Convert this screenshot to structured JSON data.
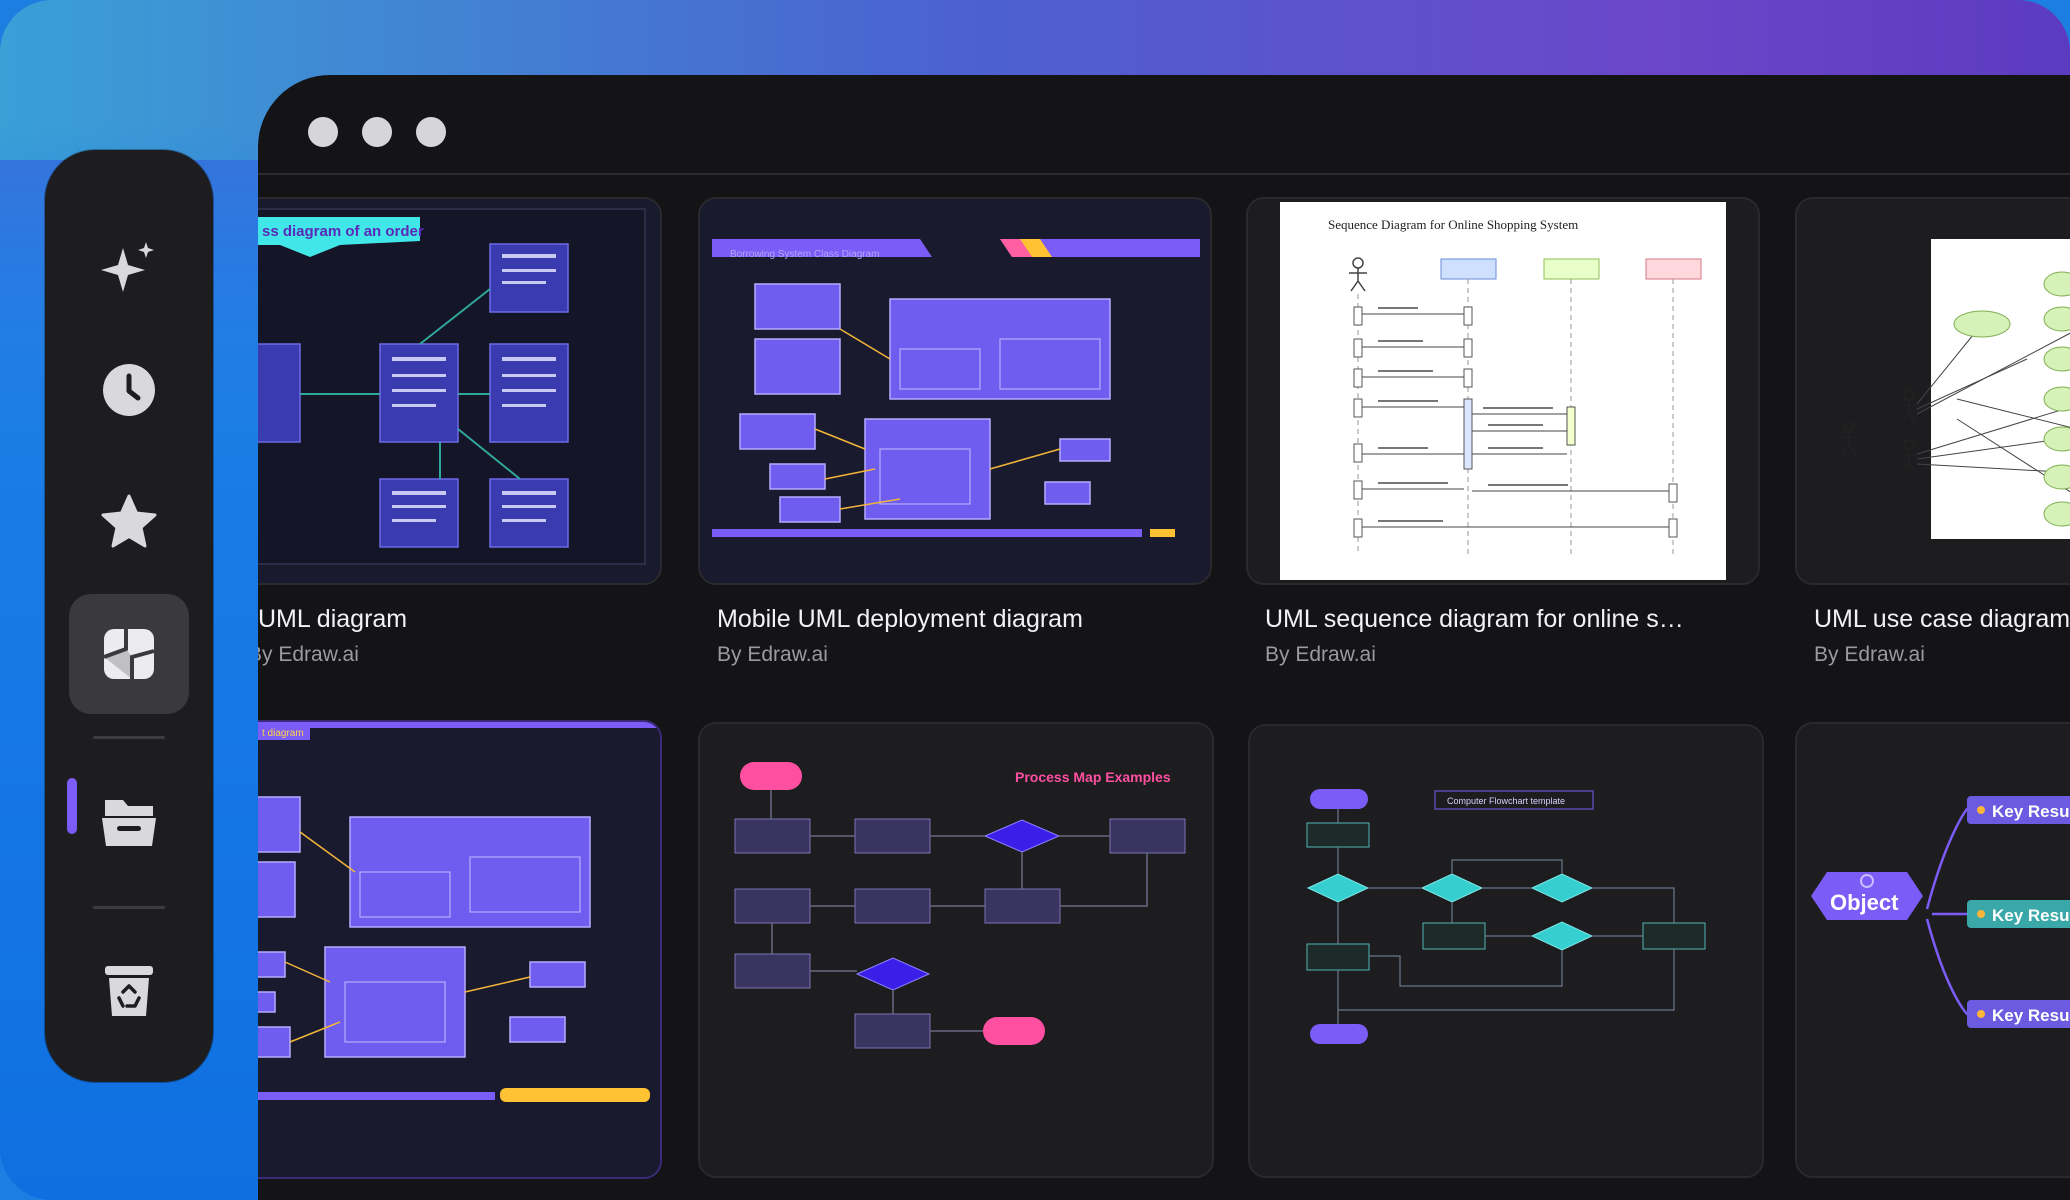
{
  "sidebar": {
    "items": [
      {
        "icon": "sparkle-icon",
        "name": "ai"
      },
      {
        "icon": "clock-icon",
        "name": "recent"
      },
      {
        "icon": "star-icon",
        "name": "favorites"
      },
      {
        "icon": "templates-icon",
        "name": "templates",
        "active": true
      },
      {
        "icon": "folder-icon",
        "name": "files"
      },
      {
        "icon": "recycle-bin-icon",
        "name": "trash"
      }
    ]
  },
  "templates": [
    {
      "title": "UML diagram",
      "author": "By Edraw.ai",
      "thumb_label": "ss diagram of an order"
    },
    {
      "title": "Mobile UML deployment diagram",
      "author": "By Edraw.ai",
      "thumb_label": "Borrowing System Class Diagram"
    },
    {
      "title": "UML sequence diagram for online s…",
      "author": "By Edraw.ai",
      "thumb_label": "Sequence Diagram for Online Shopping System"
    },
    {
      "title": "UML use case diagram",
      "author": "By Edraw.ai"
    },
    {
      "title": "",
      "author": "",
      "thumb_label": "t diagram"
    },
    {
      "title": "",
      "author": "",
      "thumb_label": "Process Map Examples"
    },
    {
      "title": "",
      "author": "",
      "thumb_label": "Computer Flowchart template"
    },
    {
      "title": "",
      "author": "",
      "thumb_label": "Object",
      "branches": [
        "Key Resu",
        "Key Resu",
        "Key Resu"
      ]
    }
  ],
  "colors": {
    "accent": "#7c5cf6",
    "window": "#141416",
    "card": "#1d1d20"
  }
}
